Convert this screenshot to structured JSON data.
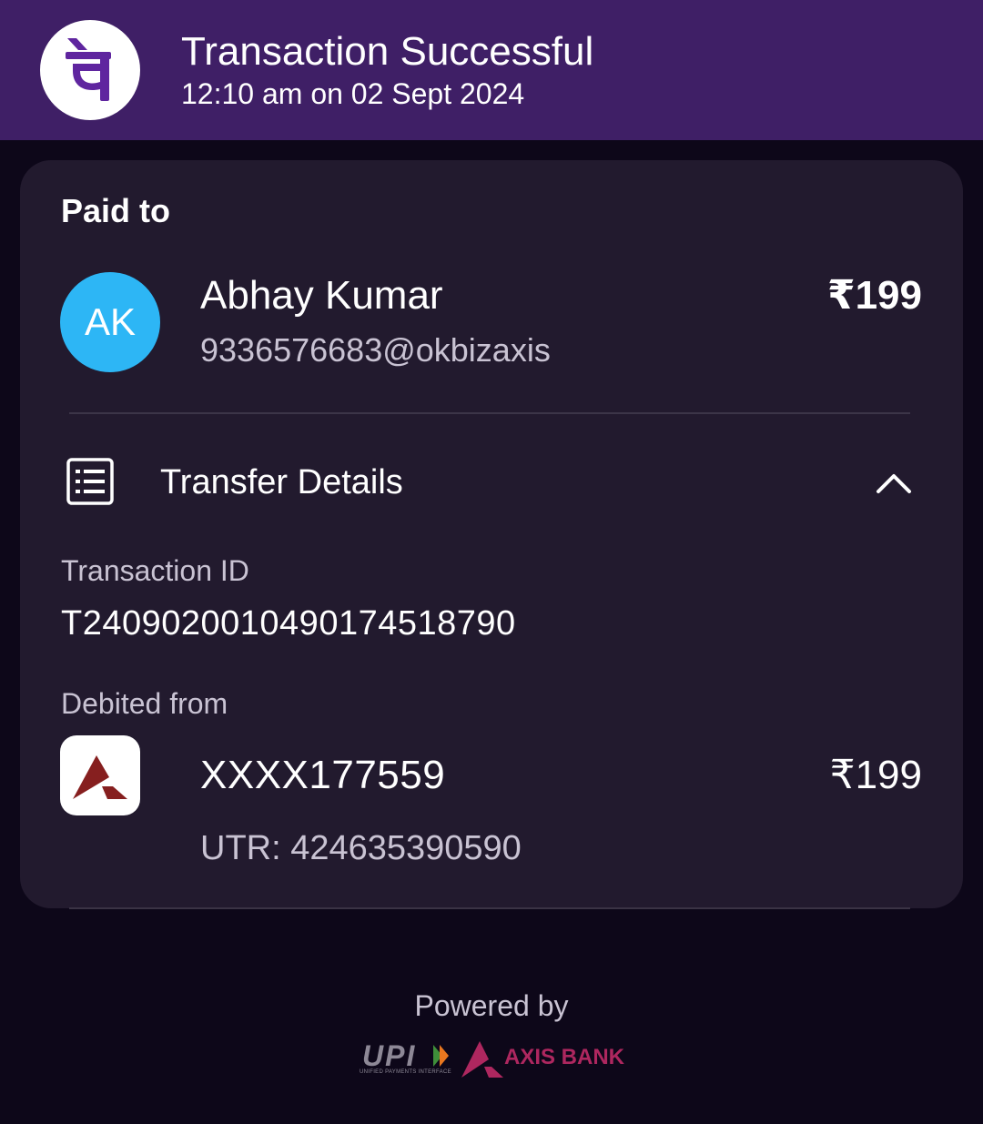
{
  "header": {
    "title": "Transaction Successful",
    "timestamp": "12:10 am on 02 Sept 2024",
    "app_logo_icon": "phonepe-logo-icon",
    "background_color": "#3f1f66"
  },
  "payment": {
    "section_label": "Paid to",
    "payee_initials": "AK",
    "payee_name": "Abhay Kumar",
    "payee_vpa": "9336576683@okbizaxis",
    "amount": "₹199",
    "avatar_color": "#2db6f5"
  },
  "transfer_details": {
    "title": "Transfer Details",
    "icon": "receipt-list-icon",
    "toggle_icon": "chevron-up-icon",
    "transaction_id_label": "Transaction ID",
    "transaction_id": "T2409020010490174518790",
    "debited_from_label": "Debited from",
    "account_number": "XXXX177559",
    "debit_amount": "₹199",
    "utr": "UTR: 424635390590",
    "bank_logo_icon": "axis-bank-logo-icon"
  },
  "footer": {
    "powered_by": "Powered by",
    "upi_logo_text": "UPI",
    "upi_subtitle": "UNIFIED PAYMENTS INTERFACE",
    "bank_name": "AXIS BANK",
    "bank_brand_color": "#ae275f"
  }
}
